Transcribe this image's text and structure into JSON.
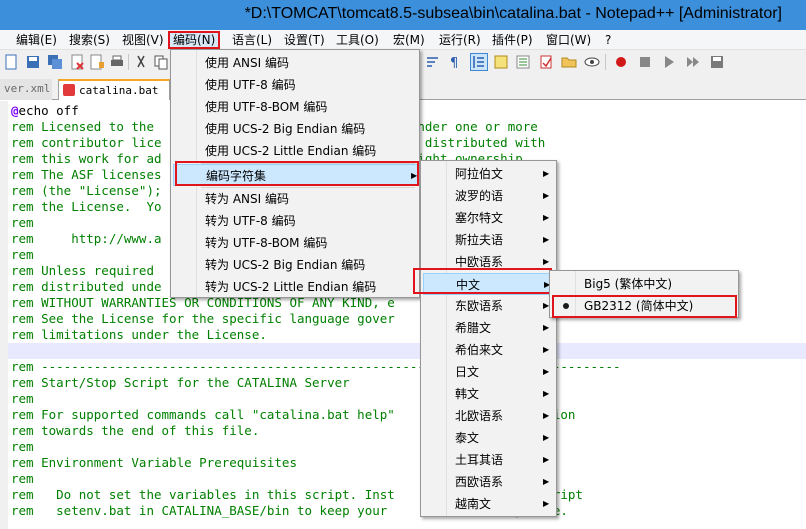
{
  "window": {
    "title": "*D:\\TOMCAT\\tomcat8.5-subsea\\bin\\catalina.bat - Notepad++ [Administrator]"
  },
  "menubar": {
    "items": [
      "编辑(E)",
      "搜索(S)",
      "视图(V)",
      "编码(N)",
      "语言(L)",
      "设置(T)",
      "工具(O)",
      "宏(M)",
      "运行(R)",
      "插件(P)",
      "窗口(W)",
      "?"
    ],
    "highlighted": "编码(N)"
  },
  "tabs": [
    {
      "label": "ver.xml",
      "active": false
    },
    {
      "label": "catalina.bat",
      "active": true
    }
  ],
  "editor": {
    "lines": [
      "@echo off",
      "rem Licensed to the                                  under one or more",
      "rem contributor lice                              file distributed with",
      "rem this work for ad                              opyright ownership.",
      "rem The ASF licenses                              ion 2.0",
      "rem (the \"License\");                              with",
      "rem the License.  Yo",
      "rem",
      "rem     http://www.a",
      "rem",
      "rem Unless required",
      "rem distributed unde",
      "rem WITHOUT WARRANTIES OR CONDITIONS OF ANY KIND, e",
      "rem See the License for the specific language gover                  and",
      "rem limitations under the License.",
      "",
      "rem -----------------------------------------------------------------------------",
      "rem Start/Stop Script for the CATALINA Server",
      "rem",
      "rem For supported commands call \"catalina.bat help\"                 section",
      "rem towards the end of this file.",
      "rem",
      "rem Environment Variable Prerequisites",
      "rem",
      "rem   Do not set the variables in this script. Inst                 a script",
      "rem   setenv.bat in CATALINA_BASE/bin to keep your                 parate."
    ]
  },
  "encoding_menu": {
    "items": [
      {
        "label": "使用 ANSI 编码",
        "submenu": false
      },
      {
        "label": "使用 UTF-8 编码",
        "submenu": false
      },
      {
        "label": "使用 UTF-8-BOM 编码",
        "submenu": false
      },
      {
        "label": "使用 UCS-2 Big Endian 编码",
        "submenu": false
      },
      {
        "label": "使用 UCS-2 Little Endian 编码",
        "submenu": false
      },
      {
        "label": "编码字符集",
        "submenu": true,
        "highlighted": true
      },
      {
        "label": "转为 ANSI 编码",
        "submenu": false
      },
      {
        "label": "转为 UTF-8 编码",
        "submenu": false
      },
      {
        "label": "转为 UTF-8-BOM 编码",
        "submenu": false
      },
      {
        "label": "转为 UCS-2 Big Endian 编码",
        "submenu": false
      },
      {
        "label": "转为 UCS-2 Little Endian 编码",
        "submenu": false
      }
    ]
  },
  "charset_menu": {
    "items": [
      {
        "label": "阿拉伯文",
        "highlighted": false
      },
      {
        "label": "波罗的语",
        "highlighted": false
      },
      {
        "label": "塞尔特文",
        "highlighted": false
      },
      {
        "label": "斯拉夫语",
        "highlighted": false
      },
      {
        "label": "中欧语系",
        "highlighted": false
      },
      {
        "label": "中文",
        "highlighted": true
      },
      {
        "label": "东欧语系",
        "highlighted": false
      },
      {
        "label": "希腊文",
        "highlighted": false
      },
      {
        "label": "希伯来文",
        "highlighted": false
      },
      {
        "label": "日文",
        "highlighted": false
      },
      {
        "label": "韩文",
        "highlighted": false
      },
      {
        "label": "北欧语系",
        "highlighted": false
      },
      {
        "label": "泰文",
        "highlighted": false
      },
      {
        "label": "土耳其语",
        "highlighted": false
      },
      {
        "label": "西欧语系",
        "highlighted": false
      },
      {
        "label": "越南文",
        "highlighted": false
      }
    ]
  },
  "chinese_menu": {
    "items": [
      {
        "label": "Big5 (繁体中文)",
        "checked": false
      },
      {
        "label": "GB2312 (简体中文)",
        "checked": true
      }
    ]
  },
  "colors": {
    "titlebar": "#3c8fdb",
    "comment": "#008000",
    "highlight_box": "#e0141c",
    "menu_hover": "#cce8ff"
  }
}
